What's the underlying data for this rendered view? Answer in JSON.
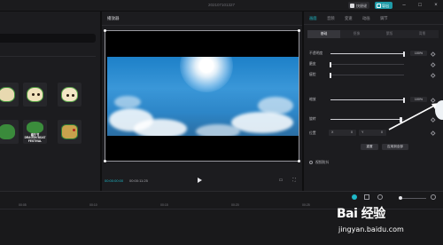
{
  "app": {
    "project_title": "202107101327",
    "shortcut_label": "快捷键",
    "export_label": "导出",
    "window_buttons": [
      "–",
      "□",
      "×"
    ]
  },
  "stickers": {
    "items": [
      {
        "name": "sticker-1",
        "text": ""
      },
      {
        "name": "sticker-2",
        "text": ""
      },
      {
        "name": "sticker-3",
        "text": ""
      },
      {
        "name": "sticker-4",
        "text": ""
      },
      {
        "name": "sticker-5",
        "text": "端午节\nDRAGON BOAT\nFESTIVAL"
      },
      {
        "name": "sticker-6",
        "text": ""
      }
    ]
  },
  "player": {
    "title": "播放器",
    "current_time": "00:00:00:00",
    "duration": "00:00:11:25",
    "play_icon": "play-icon"
  },
  "inspector": {
    "tabs": [
      "画面",
      "音频",
      "变速",
      "动画",
      "调节"
    ],
    "active_tab": "画面",
    "subtabs": [
      "基础",
      "抠像",
      "蒙版",
      "背景"
    ],
    "active_subtab": "基础",
    "rows": [
      {
        "label": "不透明度",
        "value": "100%",
        "fill": 1.0
      },
      {
        "label": "磨皮",
        "value": "0",
        "fill": 0.0
      },
      {
        "label": "瘦脸",
        "value": "0",
        "fill": 0.0
      },
      {
        "label": "缩放",
        "value": "100%",
        "fill": 1.0
      },
      {
        "label": "旋转",
        "value": "0°",
        "fill": 0.96
      }
    ],
    "position": {
      "label": "位置",
      "x_label": "X",
      "x_value": "0",
      "y_label": "Y",
      "y_value": "0"
    },
    "buttons": {
      "reset": "重置",
      "apply_all": "应用到全部"
    },
    "video_anti_shake": "视频防抖",
    "accent": "#1fb8c7"
  },
  "timeline": {
    "ruler": [
      "00:05",
      "00:10",
      "00:15",
      "00:20",
      "00:25"
    ]
  },
  "watermark": {
    "logo": "Bai 经验",
    "url": "jingyan.baidu.com"
  }
}
